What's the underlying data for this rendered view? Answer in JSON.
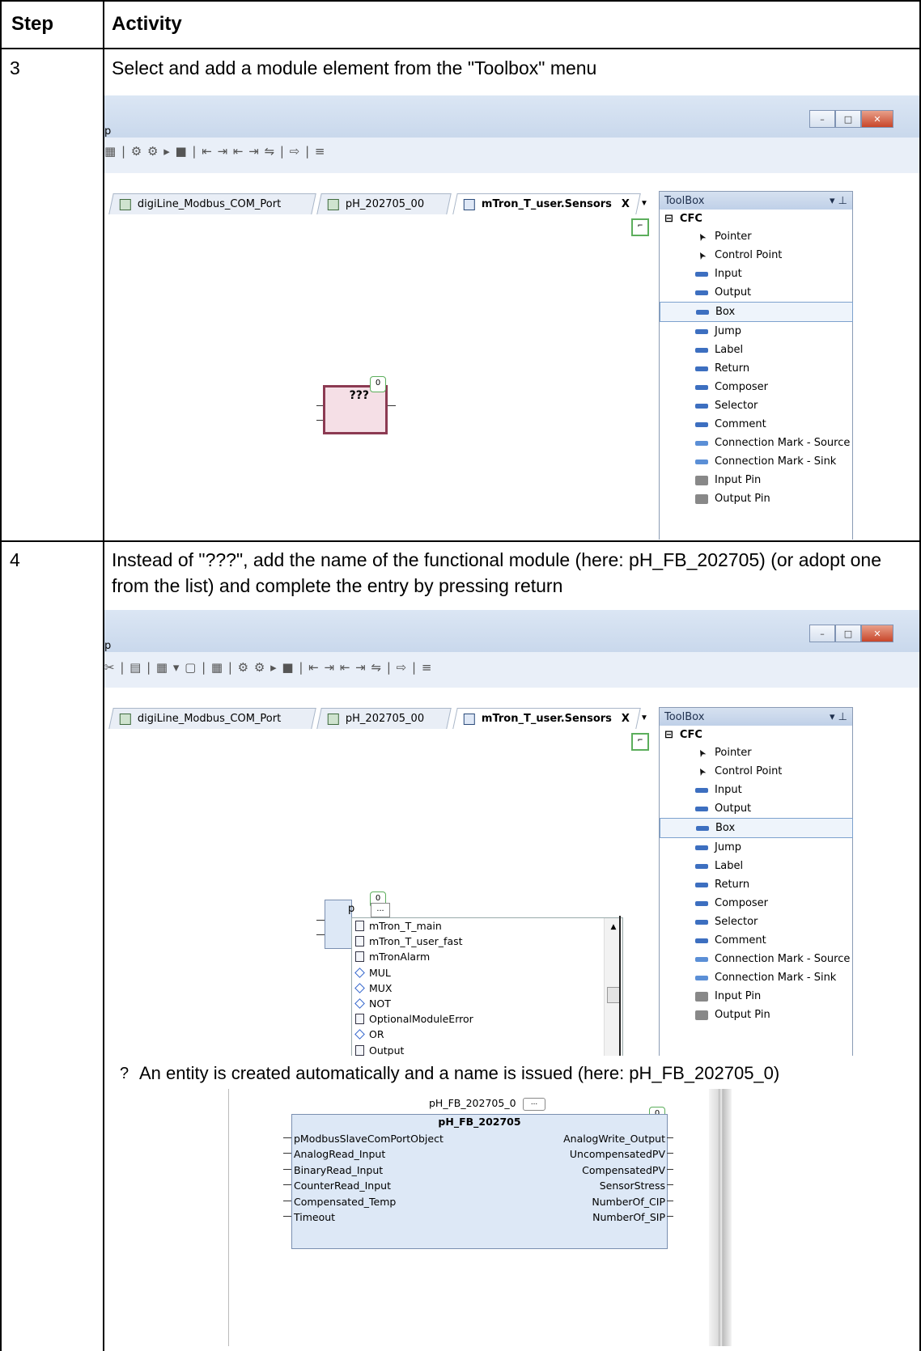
{
  "table": {
    "col_step": "Step",
    "col_activity": "Activity",
    "rows": [
      {
        "step": "3",
        "activity": "Select and add a module element from the \"Toolbox\" menu"
      },
      {
        "step": "4",
        "activity": "Instead of \"???\", add the name of the functional module (here: pH_FB_202705) (or adopt one from the list) and complete the entry by pressing return"
      }
    ]
  },
  "screenshot1": {
    "menu_fragment": "p",
    "toolbar_glyphs": "▦ | ⚙ ⚙  ▸ ■ | ⇤ ⇥ ⇤ ⇥ ⇋ | ⇨ | ≡",
    "tabs": [
      "digiLine_Modbus_COM_Port",
      "pH_202705_00",
      "mTron_T_user.Sensors"
    ],
    "tab_close": "X",
    "box_label": "???",
    "box_order": "0",
    "toolbox_title": "ToolBox",
    "toolbox_group": "CFC",
    "toolbox_items": [
      "Pointer",
      "Control Point",
      "Input",
      "Output",
      "Box",
      "Jump",
      "Label",
      "Return",
      "Composer",
      "Selector",
      "Comment",
      "Connection Mark - Source",
      "Connection Mark - Sink",
      "Input Pin",
      "Output Pin"
    ],
    "toolbox_selected": "Box"
  },
  "screenshot2": {
    "menu_fragment": "p",
    "toolbar_glyphs": "✂ | ▤ | ▦ ▾ ▢ | ▦ | ⚙ ⚙  ▸ ■ | ⇤ ⇥ ⇤ ⇥ ⇋ | ⇨ | ≡",
    "tabs": [
      "digiLine_Modbus_COM_Port",
      "pH_202705_00",
      "mTron_T_user.Sensors"
    ],
    "tab_close": "X",
    "box_text": "p",
    "box_order": "0",
    "ellipsis": "...",
    "autocomplete": [
      {
        "icon": "doc",
        "text": "mTron_T_main"
      },
      {
        "icon": "doc",
        "text": "mTron_T_user_fast"
      },
      {
        "icon": "doc",
        "text": "mTronAlarm"
      },
      {
        "icon": "dia",
        "text": "MUL"
      },
      {
        "icon": "dia",
        "text": "MUX"
      },
      {
        "icon": "dia",
        "text": "NOT"
      },
      {
        "icon": "doc",
        "text": "OptionalModuleError"
      },
      {
        "icon": "dia",
        "text": "OR"
      },
      {
        "icon": "doc",
        "text": "Output"
      }
    ],
    "toolbox_title": "ToolBox",
    "toolbox_group": "CFC",
    "toolbox_items": [
      "Pointer",
      "Control Point",
      "Input",
      "Output",
      "Box",
      "Jump",
      "Label",
      "Return",
      "Composer",
      "Selector",
      "Comment",
      "Connection Mark - Source",
      "Connection Mark - Sink",
      "Input Pin",
      "Output Pin"
    ],
    "toolbox_selected": "Box"
  },
  "result_note": {
    "bullet": "?",
    "text": "An entity is created automatically and a name is issued (here: pH_FB_202705_0)"
  },
  "screenshot3": {
    "instance_name": "pH_FB_202705_0",
    "ellipsis": "...",
    "type_name": "pH_FB_202705",
    "order": "0",
    "inputs": [
      "pModbusSlaveComPortObject",
      "AnalogRead_Input",
      "BinaryRead_Input",
      "CounterRead_Input",
      "Compensated_Temp",
      "Timeout"
    ],
    "outputs": [
      "AnalogWrite_Output",
      "UncompensatedPV",
      "CompensatedPV",
      "SensorStress",
      "NumberOf_CIP",
      "NumberOf_SIP"
    ]
  }
}
